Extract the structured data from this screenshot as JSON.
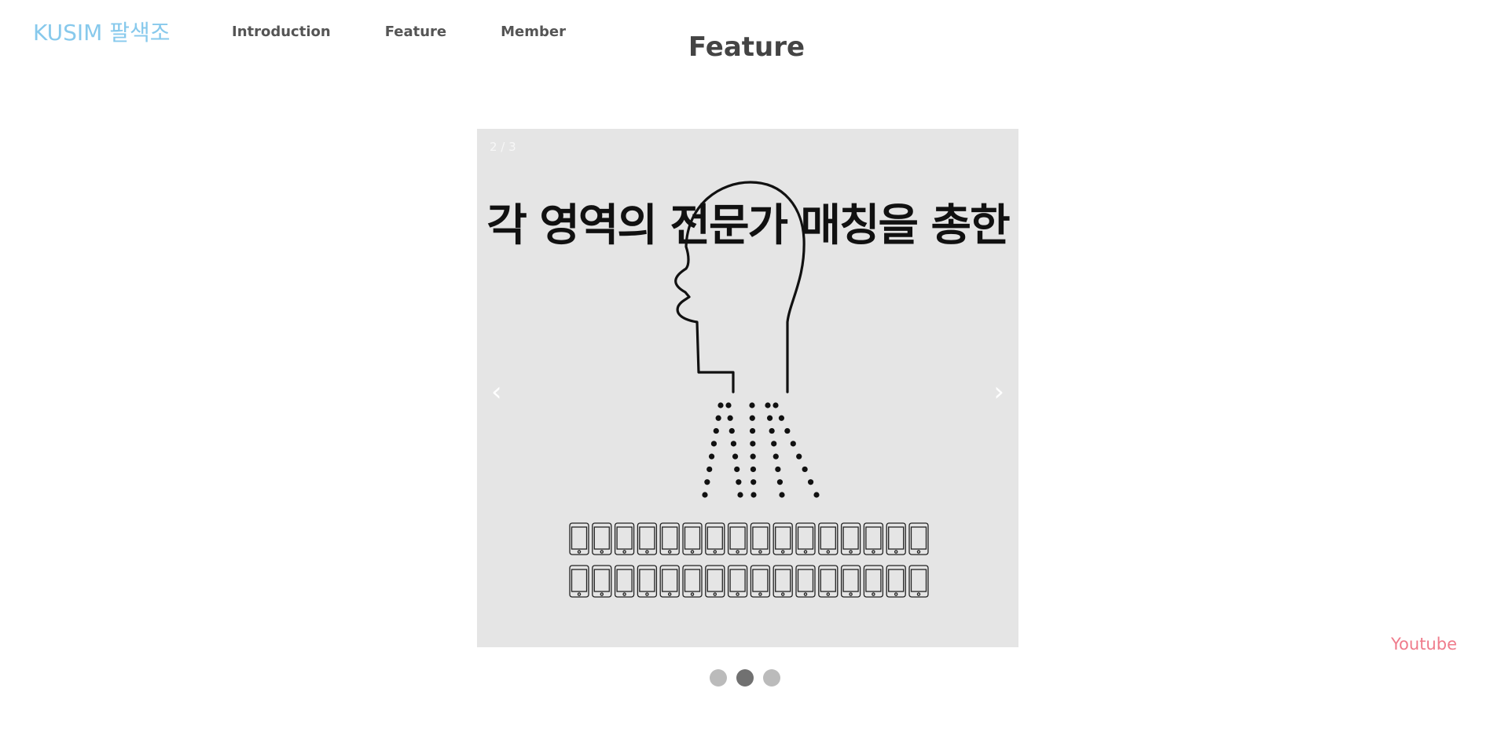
{
  "header": {
    "brand": "KUSIM 팔색조",
    "nav": [
      "Introduction",
      "Feature",
      "Member"
    ]
  },
  "section": {
    "title": "Feature"
  },
  "slideshow": {
    "counter": "2 / 3",
    "headline": "각 영역의 전문가 매칭을 총한",
    "prev_icon": "‹",
    "next_icon": "›",
    "dots_total": 3,
    "dots_active_index": 1,
    "illustration": "head-silhouette-speaking-to-phones"
  },
  "footer": {
    "youtube_label": "Youtube"
  },
  "colors": {
    "brand": "#87c9ec",
    "youtube": "#ef7b8b",
    "slide_bg": "#e5e5e5",
    "dot": "#bbbbbb",
    "dot_active": "#717171"
  }
}
